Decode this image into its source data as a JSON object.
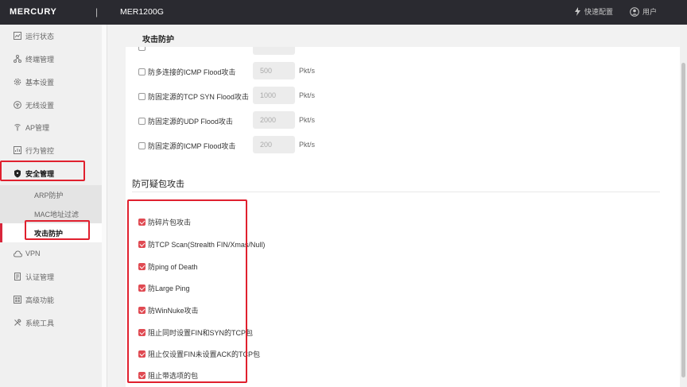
{
  "header": {
    "brand": "MERCURY",
    "separator": "|",
    "model": "MER1200G",
    "quick_setup": "快速配置",
    "user": "用户"
  },
  "sidebar": {
    "items": [
      {
        "label": "运行状态",
        "icon": "monitor-icon"
      },
      {
        "label": "终端管理",
        "icon": "network-icon"
      },
      {
        "label": "基本设置",
        "icon": "gear-icon"
      },
      {
        "label": "无线设置",
        "icon": "wifi-icon"
      },
      {
        "label": "AP管理",
        "icon": "ap-icon"
      },
      {
        "label": "行为管控",
        "icon": "behavior-icon"
      },
      {
        "label": "安全管理",
        "icon": "shield-icon"
      },
      {
        "label": "VPN",
        "icon": "cloud-icon"
      },
      {
        "label": "认证管理",
        "icon": "auth-icon"
      },
      {
        "label": "高级功能",
        "icon": "advanced-icon"
      },
      {
        "label": "系统工具",
        "icon": "tools-icon"
      }
    ],
    "sub_items": [
      {
        "label": "ARP防护"
      },
      {
        "label": "MAC地址过滤"
      },
      {
        "label": "攻击防护"
      }
    ]
  },
  "main": {
    "page_title": "攻击防护",
    "flood_rows": [
      {
        "label": "防多连接的ICMP Flood攻击",
        "value": "500",
        "unit": "Pkt/s"
      },
      {
        "label": "防固定源的TCP SYN Flood攻击",
        "value": "1000",
        "unit": "Pkt/s"
      },
      {
        "label": "防固定源的UDP Flood攻击",
        "value": "2000",
        "unit": "Pkt/s"
      },
      {
        "label": "防固定源的ICMP Flood攻击",
        "value": "200",
        "unit": "Pkt/s"
      }
    ],
    "suspicious_title": "防可疑包攻击",
    "suspicious_rows": [
      {
        "label": "防碎片包攻击"
      },
      {
        "label": "防TCP Scan(Strealth FIN/Xmas/Null)"
      },
      {
        "label": "防ping of Death"
      },
      {
        "label": "防Large Ping"
      },
      {
        "label": "防WinNuke攻击"
      },
      {
        "label": "阻止同时设置FIN和SYN的TCP包"
      },
      {
        "label": "阻止仅设置FIN未设置ACK的TCP包"
      },
      {
        "label": "阻止带选项的包"
      }
    ]
  },
  "colors": {
    "accent": "#d8263b",
    "highlight": "#e0202e",
    "checked": "#e04a52",
    "topbar": "#2a2a30"
  }
}
